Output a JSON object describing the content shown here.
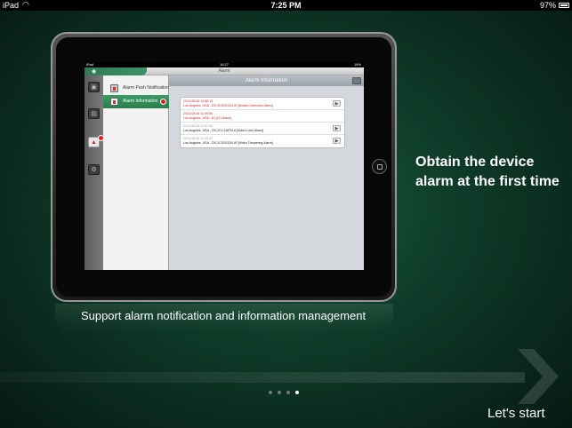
{
  "statusbar": {
    "device": "iPad",
    "time": "7:25 PM",
    "battery": "97%"
  },
  "screen": {
    "status": {
      "device": "iPad",
      "time": "16:27",
      "battery": "18%"
    },
    "title": "Alarm",
    "sidebar": [
      {
        "label": "Alarm Push Notification",
        "active": false
      },
      {
        "label": "Alarm Information",
        "active": true,
        "badge": ""
      }
    ],
    "main_title": "Alarm Information",
    "records": [
      {
        "time": "2013-08-06 11:58:13",
        "detail": "Los Angeles, USA - DS-2CD2012N-IR [Motion Detection Alarm]",
        "unread": true,
        "camera": true
      },
      {
        "time": "2013-08-06 11:49:56",
        "detail": "Los Angeles, USA - A1 [I/O Alarm]",
        "unread": true,
        "camera": false
      },
      {
        "time": "2013-08-06 11:47:59",
        "detail": "Los Angeles, USA - DS-2CC1187N-A [Video Loss Alarm]",
        "unread": false,
        "camera": true
      },
      {
        "time": "2013-08-06 11:45:27",
        "detail": "Los Angeles, USA - DS-2CD2012N-IR [Video Tampering Alarm]",
        "unread": false,
        "camera": true
      }
    ]
  },
  "caption": "Support alarm notification and information management",
  "headline": "Obtain the device alarm at the first time",
  "pagination": {
    "count": 4,
    "active": 4
  },
  "start_label": "Let's start",
  "colors": {
    "accent": "#2f8a58",
    "alarm_red": "#d62020",
    "background": "#0e3a28"
  }
}
